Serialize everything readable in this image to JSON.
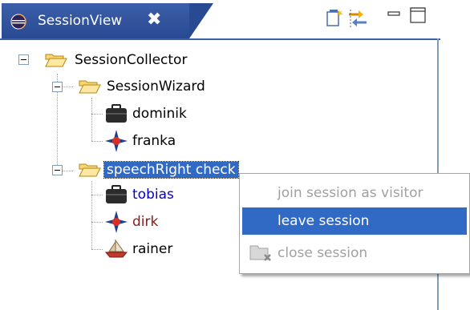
{
  "view": {
    "tab_title": "SessionView",
    "close_glyph": "✖"
  },
  "tree": {
    "root": {
      "label": "SessionCollector",
      "icon": "open-folder-icon"
    },
    "sessions": [
      {
        "label": "SessionWizard",
        "icon": "open-folder-icon",
        "members": [
          {
            "label": "dominik",
            "icon": "briefcase-user-icon"
          },
          {
            "label": "franka",
            "icon": "compass-user-icon"
          }
        ]
      },
      {
        "label": "speechRight check",
        "icon": "open-folder-icon",
        "selected": true,
        "members": [
          {
            "label": "tobias",
            "icon": "briefcase-user-icon",
            "color": "#0000cc"
          },
          {
            "label": "dirk",
            "icon": "compass-user-icon",
            "color": "#8b1a1a"
          },
          {
            "label": "rainer",
            "icon": "boat-user-icon"
          }
        ]
      }
    ]
  },
  "context_menu": {
    "items": [
      {
        "label": "join session as visitor",
        "enabled": false
      },
      {
        "label": "leave session",
        "enabled": true,
        "highlighted": true
      },
      {
        "label": "close session",
        "enabled": false,
        "icon": "close-session-icon"
      }
    ]
  },
  "colors": {
    "tab_active": "#284a93",
    "selection": "#316ac5",
    "disabled_text": "#a0a0a0"
  }
}
